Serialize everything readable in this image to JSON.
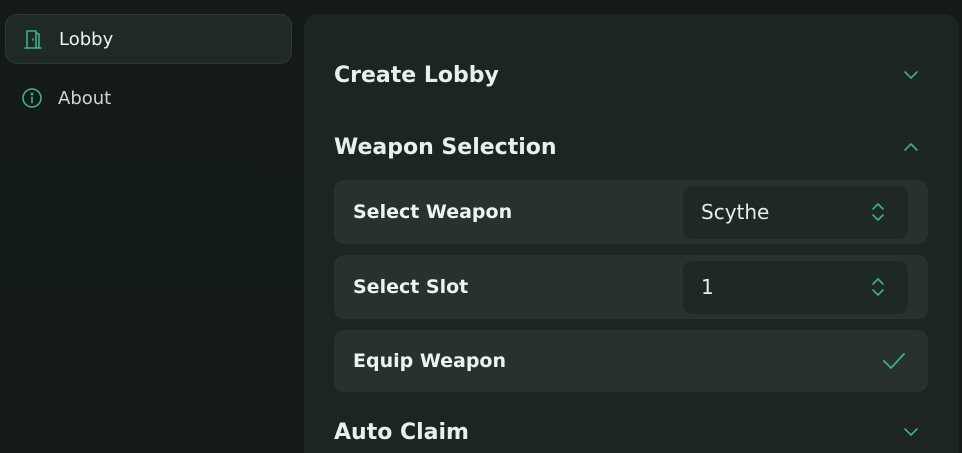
{
  "sidebar": {
    "items": [
      {
        "label": "Lobby",
        "icon": "door-icon",
        "active": true
      },
      {
        "label": "About",
        "icon": "info-icon",
        "active": false
      }
    ]
  },
  "main": {
    "sections": [
      {
        "title": "Create Lobby",
        "expanded": false
      },
      {
        "title": "Weapon Selection",
        "expanded": true
      },
      {
        "title": "Auto Claim",
        "expanded": false
      }
    ],
    "weapon_selection": {
      "select_weapon": {
        "label": "Select Weapon",
        "value": "Scythe"
      },
      "select_slot": {
        "label": "Select Slot",
        "value": "1"
      },
      "equip_weapon": {
        "label": "Equip Weapon",
        "checked": true
      }
    }
  },
  "colors": {
    "accent": "#3fb27f",
    "panel": "#1c2522",
    "row": "#27322f",
    "background": "#131a18"
  }
}
